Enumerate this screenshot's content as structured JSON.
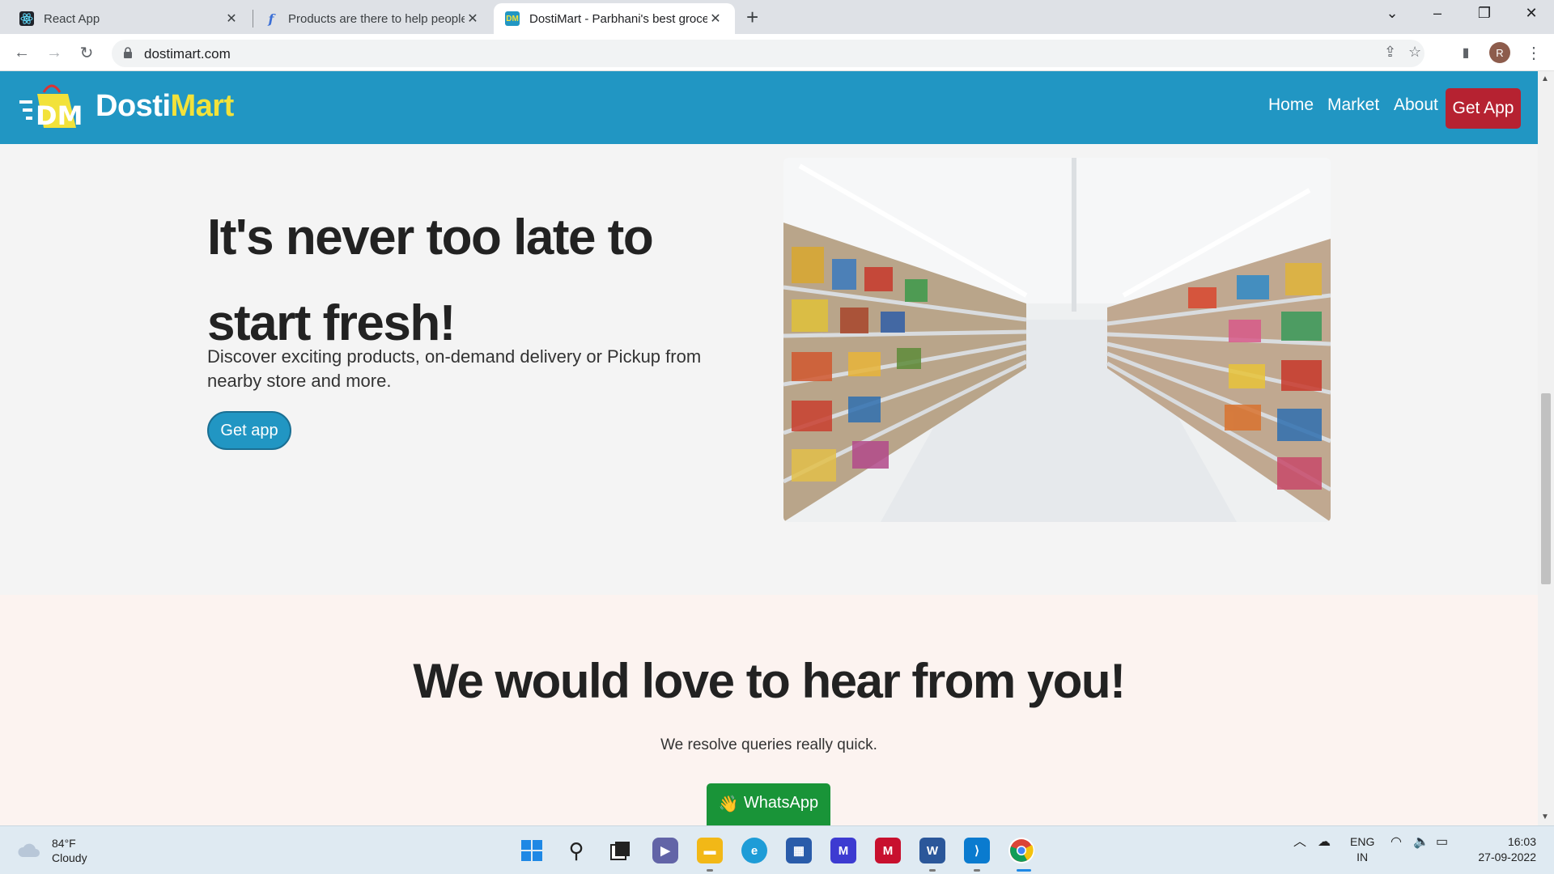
{
  "browser": {
    "tabs": [
      {
        "title": "React App",
        "active": false
      },
      {
        "title": "Products are there to help people",
        "active": false
      },
      {
        "title": "DostiMart - Parbhani's best grocery",
        "active": true
      }
    ],
    "new_tab": "+",
    "url": "dostimart.com",
    "profile_initial": "R"
  },
  "site": {
    "brand_part1": "Dosti",
    "brand_part2": "Mart",
    "logo_letters": "DM",
    "nav": {
      "home": "Home",
      "market": "Market",
      "about": "About",
      "get_app": "Get App"
    },
    "hero": {
      "title": "It's never too late to start fresh!",
      "text": "Discover exciting products, on-demand delivery or Pickup from nearby store and more.",
      "button": "Get app"
    },
    "contact": {
      "title": "We would love to hear from you!",
      "subtitle": "We resolve queries really quick.",
      "whatsapp_emoji": "👋",
      "whatsapp": "WhatsApp"
    }
  },
  "taskbar": {
    "weather_temp": "84°F",
    "weather_desc": "Cloudy",
    "lang_line1": "ENG",
    "lang_line2": "IN",
    "time": "16:03",
    "date": "27-09-2022"
  },
  "colors": {
    "nav_bg": "#2196c3",
    "brand_accent": "#f2e23a",
    "get_app_red": "#b62231",
    "whatsapp_green": "#199438",
    "contact_bg": "#fcf3f0"
  }
}
